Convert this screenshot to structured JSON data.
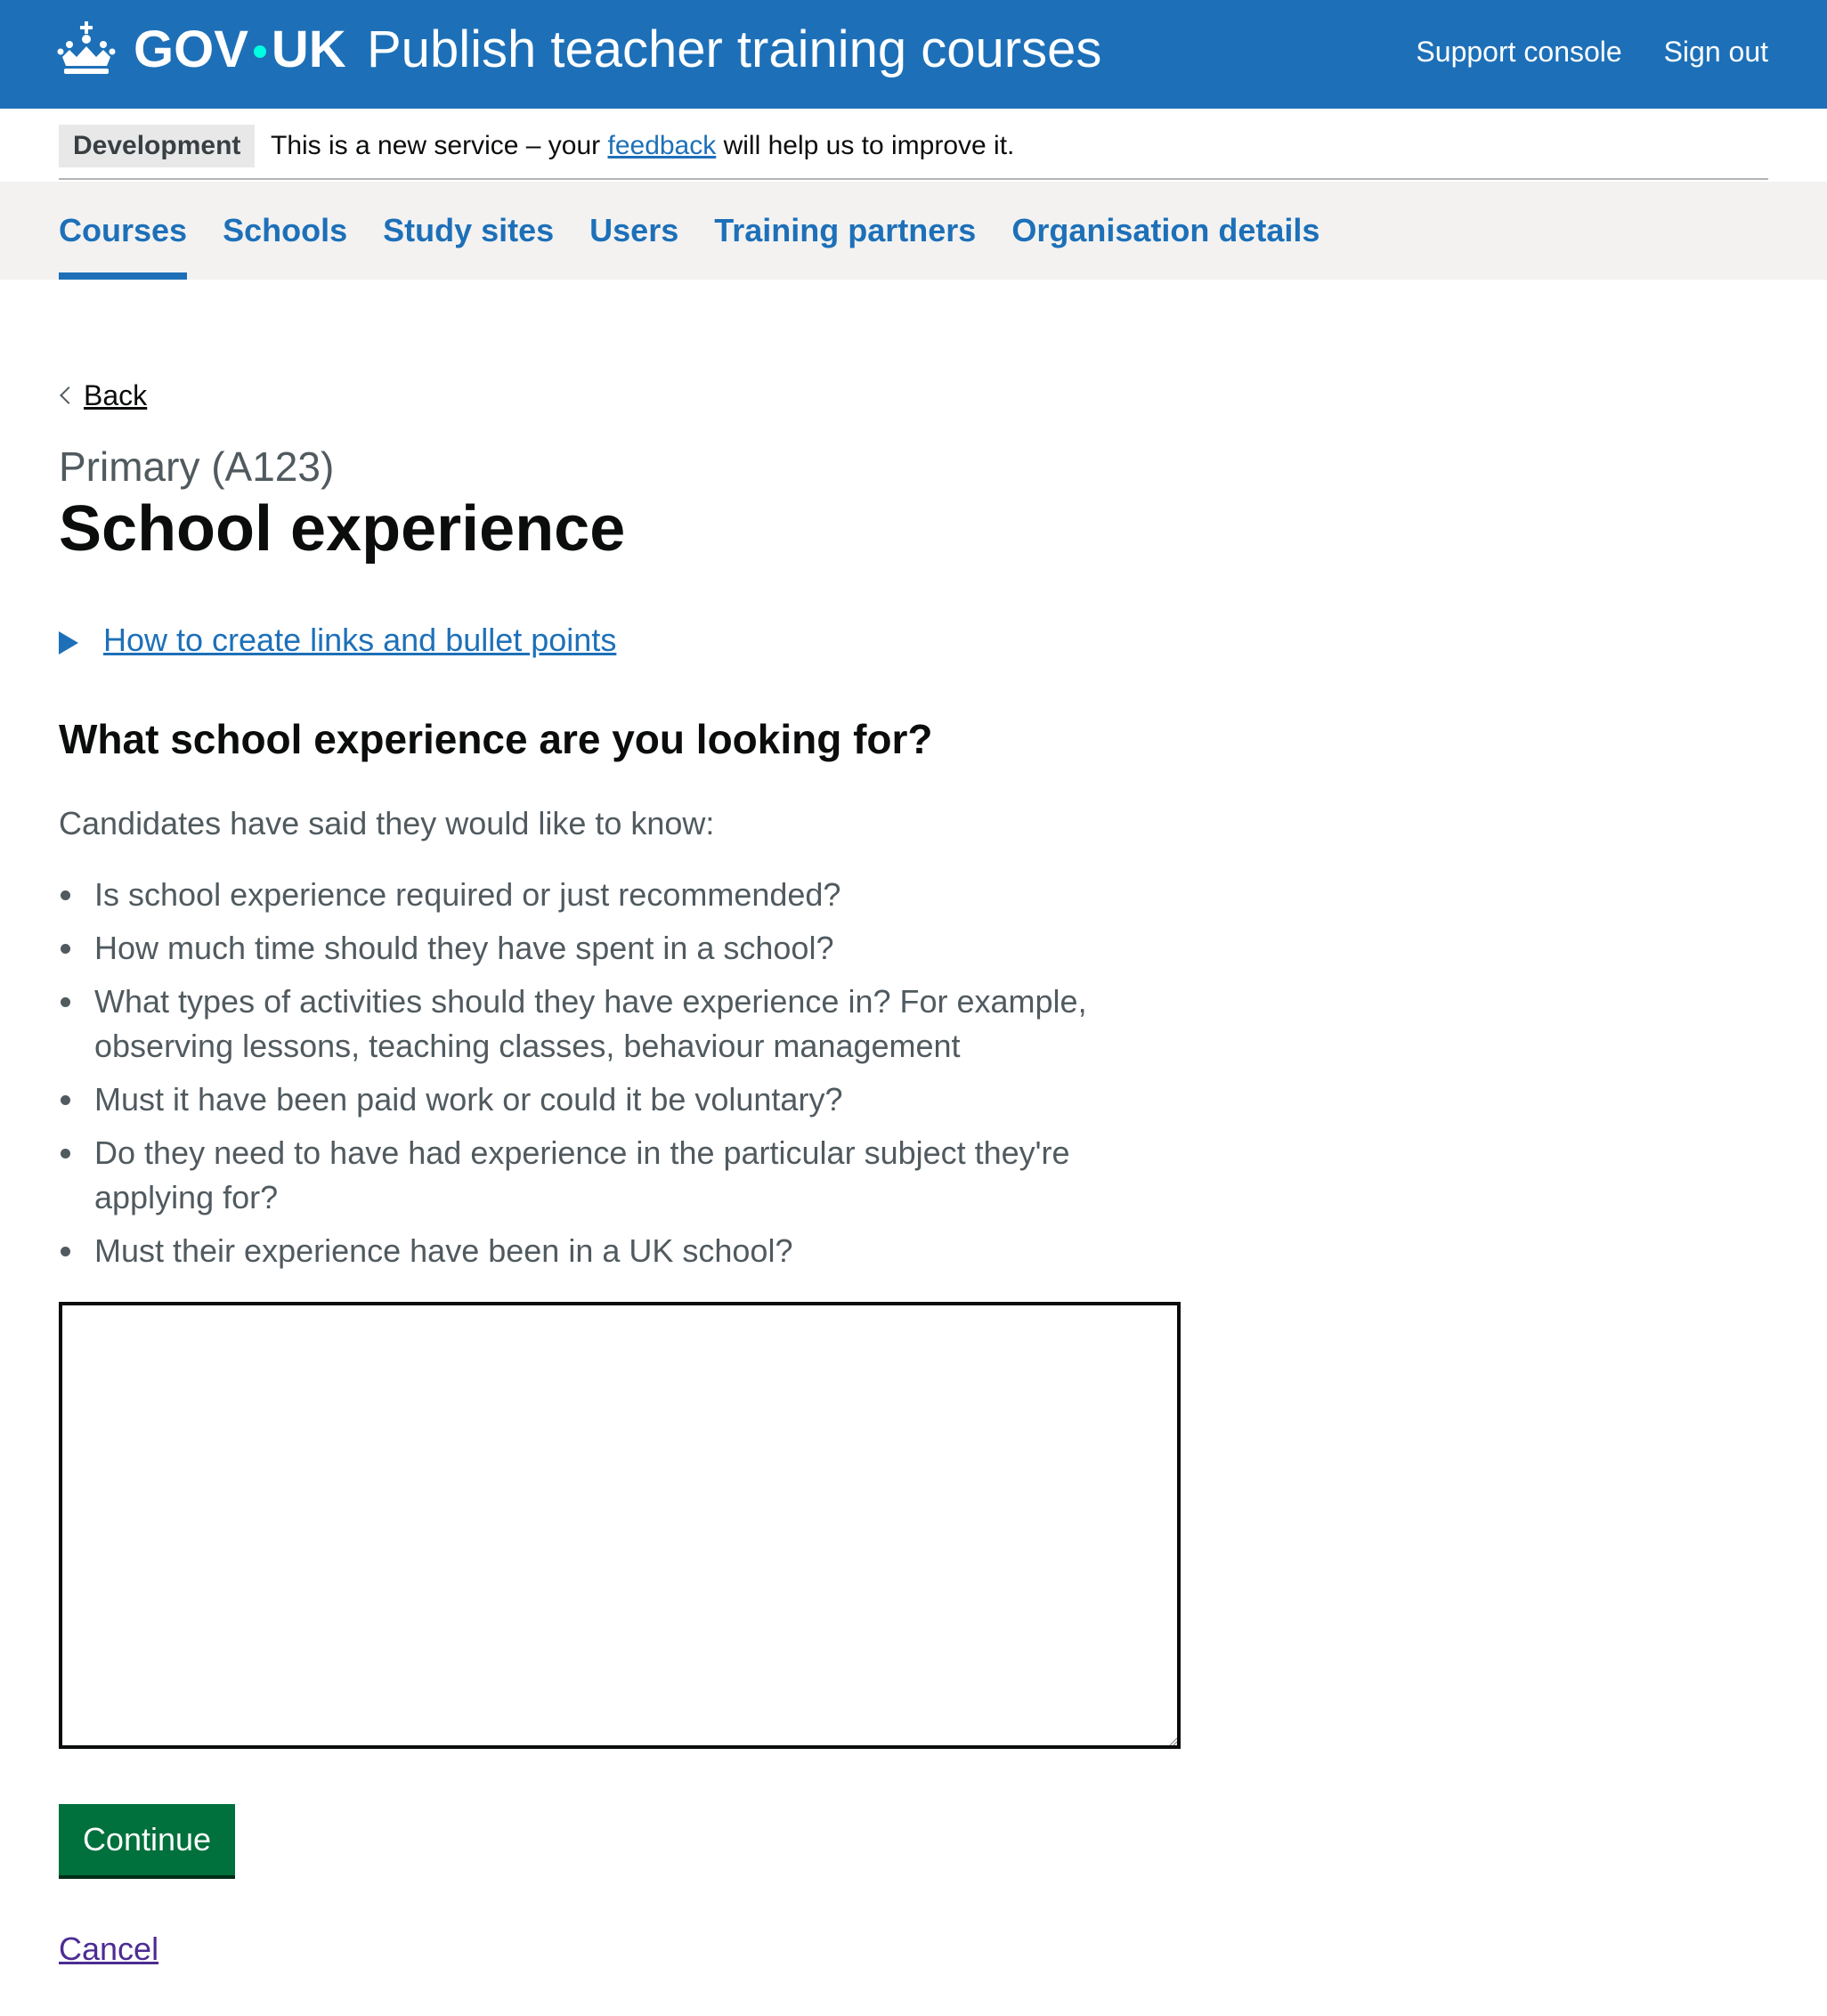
{
  "header": {
    "logo_left": "GOV",
    "logo_right": "UK",
    "service_name": "Publish teacher training courses",
    "nav": [
      {
        "label": "Support console"
      },
      {
        "label": "Sign out"
      }
    ],
    "background_color": "#1d70b8"
  },
  "phase_banner": {
    "tag": "Development",
    "text_before": "This is a new service – your ",
    "link": "feedback",
    "text_after": " will help us to improve it."
  },
  "primary_nav": {
    "items": [
      {
        "label": "Courses",
        "active": true
      },
      {
        "label": "Schools",
        "active": false
      },
      {
        "label": "Study sites",
        "active": false
      },
      {
        "label": "Users",
        "active": false
      },
      {
        "label": "Training partners",
        "active": false
      },
      {
        "label": "Organisation details",
        "active": false
      }
    ]
  },
  "main": {
    "back_label": "Back",
    "caption": "Primary (A123)",
    "title": "School experience",
    "details_summary": "How to create links and bullet points",
    "question": "What school experience are you looking for?",
    "hint_lead": "Candidates have said they would like to know:",
    "hint_items": [
      "Is school experience required or just recommended?",
      "How much time should they have spent in a school?",
      "What types of activities should they have experience in? For example, observing lessons, teaching classes, behaviour management",
      "Must it have been paid work or could it be voluntary?",
      "Do they need to have had experience in the particular subject they're applying for?",
      "Must their experience have been in a UK school?"
    ],
    "textarea_value": "",
    "continue_label": "Continue",
    "cancel_label": "Cancel"
  },
  "colors": {
    "brand_blue": "#1d70b8",
    "button_green": "#00703c",
    "visited_link": "#4c2c92",
    "secondary_text": "#505a5f"
  }
}
